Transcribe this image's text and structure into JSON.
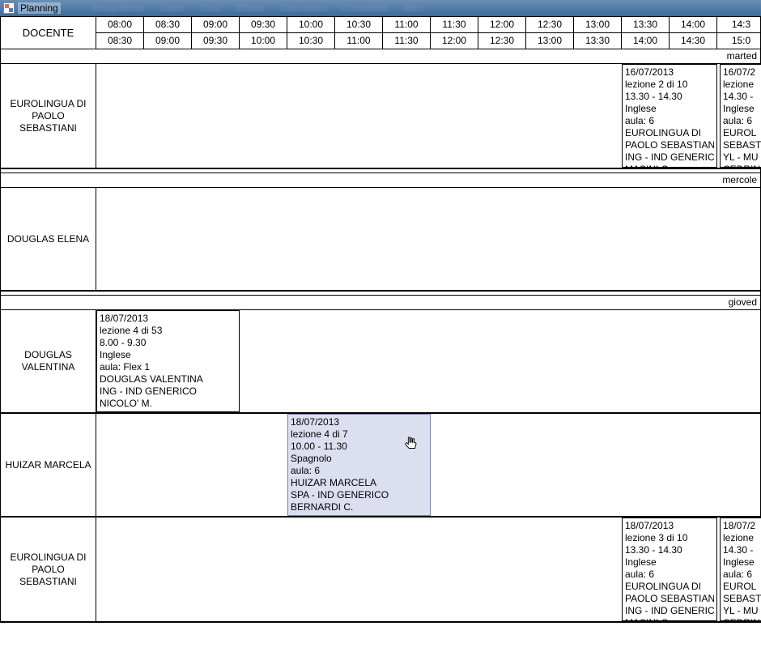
{
  "window": {
    "title": "Planning"
  },
  "menubar": [
    "Anagrafiche",
    "Listini",
    "Corsi",
    "Offerte",
    "Operazioni",
    "Contabilità",
    "Altro"
  ],
  "header": {
    "docente": "DOCENTE",
    "times_top": [
      "08:00",
      "08:30",
      "09:00",
      "09:30",
      "10:00",
      "10:30",
      "11:00",
      "11:30",
      "12:00",
      "12:30",
      "13:00",
      "13:30",
      "14:00",
      "14:3"
    ],
    "times_bot": [
      "08:30",
      "09:00",
      "09:30",
      "10:00",
      "10:30",
      "11:00",
      "11:30",
      "12:00",
      "12:30",
      "13:00",
      "13:30",
      "14:00",
      "14:30",
      "15:0"
    ]
  },
  "days": {
    "tue": "marted",
    "wed": "mercole",
    "thu": "gioved"
  },
  "teachers": {
    "eurolingua": "EUROLINGUA DI PAOLO SEBASTIANI",
    "douglas_e": "DOUGLAS ELENA",
    "douglas_v": "DOUGLAS VALENTINA",
    "huizar": "HUIZAR MARCELA"
  },
  "lessons": {
    "tue_euro_1": {
      "date": "16/07/2013",
      "lesson": "lezione 2 di 10",
      "time": "13.30 - 14.30",
      "subject": "Inglese",
      "room": "aula: 6",
      "teacher_l1": "EUROLINGUA DI",
      "teacher_l2": "PAOLO SEBASTIANI",
      "course": "ING - IND GENERICO",
      "student": "MASINI C."
    },
    "tue_euro_2": {
      "date": "16/07/2",
      "lesson": "lezione",
      "time": "14.30 -",
      "subject": "Inglese",
      "room": "aula: 6",
      "teacher_l1": "EUROL",
      "teacher_l2": "SEBAST",
      "course": "YL - MU",
      "student": "CEDRIN"
    },
    "thu_douglasv": {
      "date": "18/07/2013",
      "lesson": "lezione 4 di 53",
      "time": "8.00 - 9.30",
      "subject": "Inglese",
      "room": "aula: Flex 1",
      "teacher": "DOUGLAS VALENTINA",
      "course": "ING - IND GENERICO",
      "student": "NICOLO' M."
    },
    "thu_huizar": {
      "date": "18/07/2013",
      "lesson": "lezione 4 di 7",
      "time": "10.00 - 11.30",
      "subject": "Spagnolo",
      "room": "aula: 6",
      "teacher": "HUIZAR MARCELA",
      "course": "SPA - IND GENERICO",
      "student": "BERNARDI C."
    },
    "thu_euro_1": {
      "date": "18/07/2013",
      "lesson": "lezione 3 di 10",
      "time": "13.30 - 14.30",
      "subject": "Inglese",
      "room": "aula: 6",
      "teacher_l1": "EUROLINGUA DI",
      "teacher_l2": "PAOLO SEBASTIANI",
      "course": "ING - IND GENERICO",
      "student": "MASINI C."
    },
    "thu_euro_2": {
      "date": "18/07/2",
      "lesson": "lezione",
      "time": "14.30 -",
      "subject": "Inglese",
      "room": "aula: 6",
      "teacher_l1": "EUROL",
      "teacher_l2": "SEBAST",
      "course": "YL - MU",
      "student": "CEDRIN"
    }
  }
}
